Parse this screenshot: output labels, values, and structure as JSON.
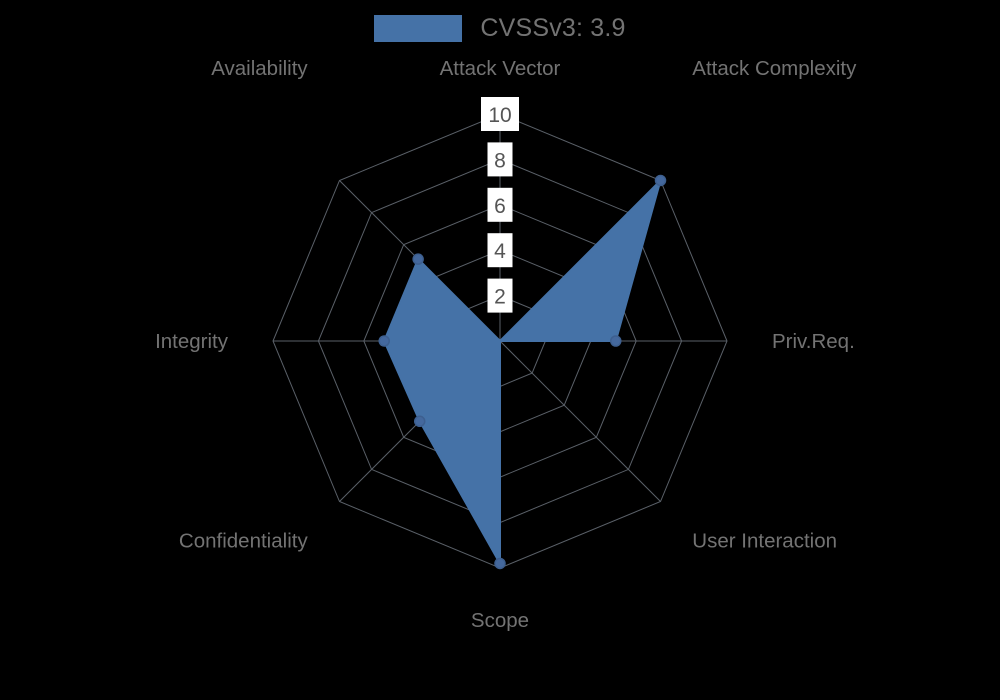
{
  "legend": {
    "label": "CVSSv3: 3.9",
    "swatch_color": "#4572a7",
    "icon": "legend-swatch"
  },
  "colors": {
    "background": "#000000",
    "series": "#4572a7",
    "grid": "#5a6068",
    "axis_label": "#737373",
    "tick_label": "#555555",
    "tick_label_background": "#ffffff"
  },
  "chart_data": {
    "type": "radar",
    "title": "CVSSv3: 3.9",
    "xlabel": "",
    "ylabel": "",
    "categories": [
      "Attack Vector",
      "Attack Complexity",
      "Priv.Req.",
      "User Interaction",
      "Scope",
      "Confidentiality",
      "Integrity",
      "Availability"
    ],
    "series": [
      {
        "name": "CVSSv3: 3.9",
        "color": "#4572a7",
        "values": [
          0,
          10,
          5.1,
          0,
          9.8,
          5,
          5.1,
          5.1
        ]
      }
    ],
    "rlim": [
      0,
      10
    ],
    "tick_values": [
      2,
      4,
      6,
      8,
      10
    ],
    "tick_labels": [
      "2",
      "4",
      "6",
      "8",
      "10"
    ],
    "grid": true,
    "legend_position": "top"
  }
}
